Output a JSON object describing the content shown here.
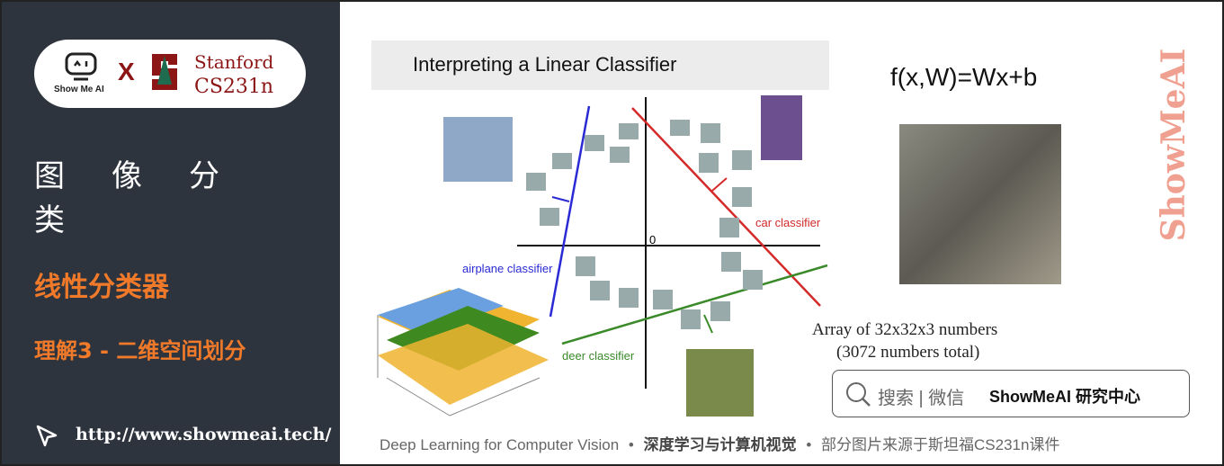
{
  "sidebar": {
    "logo_text": "Show Me AI",
    "cross": "X",
    "stanford": "Stanford",
    "course": "CS231n",
    "title": "图像分类",
    "section": "线性分类器",
    "subsection": "理解3 - 二维空间划分",
    "url": "http://www.showmeai.tech/"
  },
  "diagram": {
    "title": "Interpreting a Linear Classifier",
    "origin": "0",
    "car_label": "car classifier",
    "airplane_label": "airplane classifier",
    "deer_label": "deer classifier",
    "colors": {
      "car": "#d42a2a",
      "airplane": "#2a2ad4",
      "deer": "#3a8a2a"
    }
  },
  "formula": "f(x,W)=Wx+b",
  "array_caption": [
    "Array of 32x32x3  numbers",
    "(3072 numbers total)"
  ],
  "search": {
    "placeholder": "搜索 | 微信",
    "brand": "ShowMeAI 研究中心"
  },
  "watermark": "ShowMeAI",
  "footer": {
    "en": "Deep Learning for Computer Vision",
    "sep": "•",
    "cn_bold": "深度学习与计算机视觉",
    "note": "部分图片来源于斯坦福CS231n课件"
  }
}
